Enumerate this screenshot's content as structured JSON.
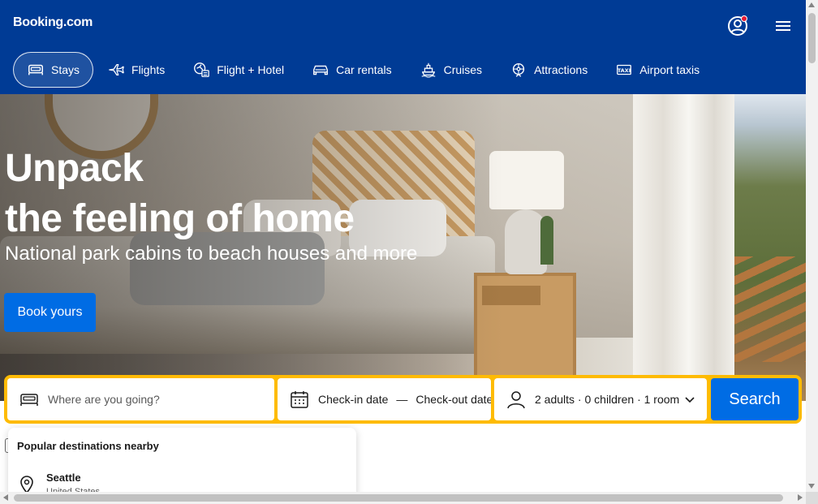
{
  "header": {
    "logo": "Booking.com",
    "colors": {
      "background": "#003b95",
      "notification_dot": "#e81932"
    },
    "icons": {
      "account": "account-circle-icon",
      "menu": "hamburger-menu-icon"
    }
  },
  "nav": {
    "items": [
      {
        "label": "Stays",
        "icon": "bed-icon",
        "active": true
      },
      {
        "label": "Flights",
        "icon": "plane-icon",
        "active": false
      },
      {
        "label": "Flight + Hotel",
        "icon": "flight-hotel-icon",
        "active": false
      },
      {
        "label": "Car rentals",
        "icon": "car-icon",
        "active": false
      },
      {
        "label": "Cruises",
        "icon": "ship-icon",
        "active": false
      },
      {
        "label": "Attractions",
        "icon": "attractions-icon",
        "active": false
      },
      {
        "label": "Airport taxis",
        "icon": "taxi-icon",
        "active": false
      }
    ]
  },
  "hero": {
    "title_line1": "Unpack",
    "title_line2": "the feeling of home",
    "subtitle": "National park cabins to beach houses and more",
    "cta": "Book yours"
  },
  "search": {
    "destination_placeholder": "Where are you going?",
    "checkin": "Check-in date",
    "dash": "—",
    "checkout": "Check-out date",
    "guests": "2 adults · 0 children · 1 room",
    "button": "Search",
    "colors": {
      "bar": "#febb02",
      "button": "#006ce4"
    }
  },
  "dropdown": {
    "title": "Popular destinations nearby",
    "items": [
      {
        "name": "Seattle",
        "country": "United States",
        "icon": "location-pin-icon"
      }
    ]
  }
}
